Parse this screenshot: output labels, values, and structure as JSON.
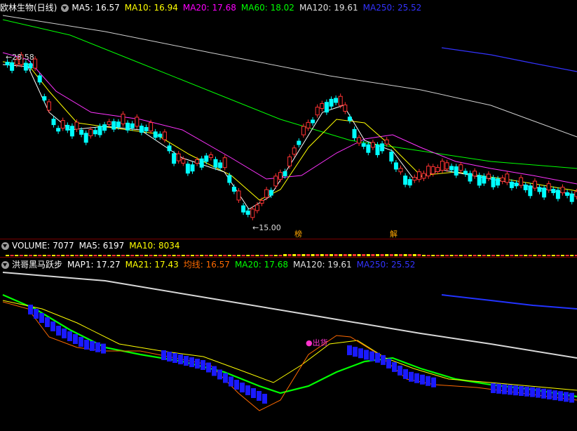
{
  "price_panel": {
    "stock_name": "欧林生物(日线)",
    "ma": [
      {
        "label": "MA5: 16.57",
        "color": "#ffffff"
      },
      {
        "label": "MA10: 16.94",
        "color": "#ffff00"
      },
      {
        "label": "MA20: 17.68",
        "color": "#ff00ff"
      },
      {
        "label": "MA60: 18.02",
        "color": "#00ff00"
      },
      {
        "label": "MA120: 19.61",
        "color": "#e0e0e0"
      },
      {
        "label": "MA250: 25.52",
        "color": "#3333ff"
      }
    ],
    "high_label": "28.58",
    "low_label": "15.00",
    "marker_bang": "榜",
    "marker_jie": "解"
  },
  "volume_panel": {
    "items": [
      {
        "label": "VOLUME: 7077",
        "color": "#ffffff"
      },
      {
        "label": "MA5: 6197",
        "color": "#ffffff"
      },
      {
        "label": "MA10: 8034",
        "color": "#ffff00"
      }
    ]
  },
  "indicator_panel": {
    "name": "洪哥黑马跃步",
    "items": [
      {
        "label": "MAP1: 17.27",
        "color": "#ffffff"
      },
      {
        "label": "MA21: 17.43",
        "color": "#ffff00"
      },
      {
        "label": "均线: 16.57",
        "color": "#ff6a00"
      },
      {
        "label": "MA20: 17.68",
        "color": "#00ff00"
      },
      {
        "label": "MA120: 19.61",
        "color": "#e0e0e0"
      },
      {
        "label": "MA250: 25.52",
        "color": "#3333ff"
      }
    ],
    "signal_label": "出货"
  }
}
